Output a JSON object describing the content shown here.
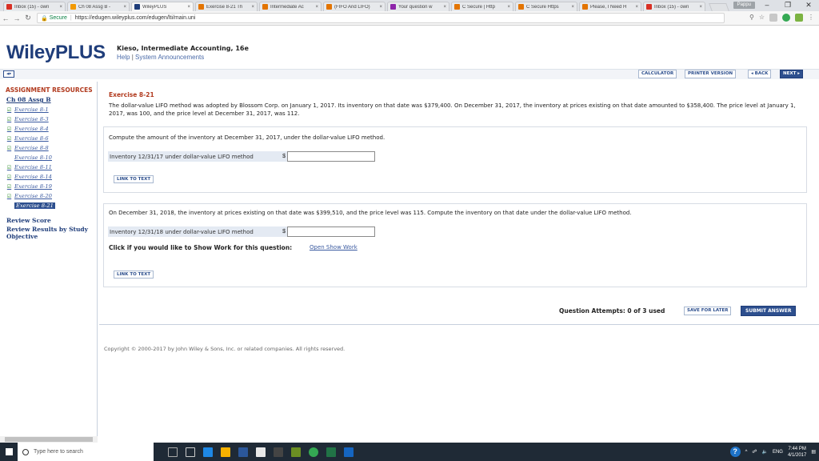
{
  "browser": {
    "tabs": [
      {
        "title": "Inbox (15) - own",
        "color": "#d93025"
      },
      {
        "title": "Ch 08 Assg B - ",
        "color": "#f29900"
      },
      {
        "title": "WileyPLUS",
        "color": "#1f3d7a",
        "active": true
      },
      {
        "title": "Exercise 8-21 Th",
        "color": "#e37400"
      },
      {
        "title": "Intermediate Ac",
        "color": "#e37400"
      },
      {
        "title": "(FIFO And LIFO)",
        "color": "#e37400"
      },
      {
        "title": "Your question w",
        "color": "#8e24aa"
      },
      {
        "title": "C Secure | Http",
        "color": "#e37400"
      },
      {
        "title": "C Secure Https",
        "color": "#e37400"
      },
      {
        "title": "Please, I Need H",
        "color": "#e37400"
      },
      {
        "title": "Inbox (15) - own",
        "color": "#d93025"
      }
    ],
    "profile_label": "Pappu",
    "secure_label": "Secure",
    "url": "https://edugen.wileyplus.com/edugen/lti/main.uni"
  },
  "header": {
    "brand": "WileyPLUS",
    "course_title": "Kieso, Intermediate Accounting, 16e",
    "help_link": "Help",
    "sep": "|",
    "announce_link": "System Announcements"
  },
  "toolbar": {
    "calculator": "CALCULATOR",
    "printer": "PRINTER VERSION",
    "back": "◂ BACK",
    "next": "NEXT ▸"
  },
  "sidebar": {
    "heading": "ASSIGNMENT RESOURCES",
    "assignment": "Ch 08 Assg B",
    "items": [
      {
        "label": "Exercise 8-1",
        "check": "☑"
      },
      {
        "label": "Exercise 8-3",
        "check": "☑"
      },
      {
        "label": "Exercise 8-4",
        "check": "☑"
      },
      {
        "label": "Exercise 8-6",
        "check": "☑"
      },
      {
        "label": "Exercise 8-8",
        "check": "☑"
      },
      {
        "label": "Exercise 8-10",
        "check": ""
      },
      {
        "label": "Exercise 8-11",
        "check": "☑"
      },
      {
        "label": "Exercise 8-14",
        "check": "☑"
      },
      {
        "label": "Exercise 8-19",
        "check": "☑"
      },
      {
        "label": "Exercise 8-20",
        "check": "☑"
      },
      {
        "label": "Exercise 8-21",
        "check": "",
        "current": true
      }
    ],
    "review_score": "Review Score",
    "review_results_line1": "Review Results by Study",
    "review_results_line2": "Objective"
  },
  "exercise": {
    "title": "Exercise 8-21",
    "text": "The dollar-value LIFO method was adopted by Blossom Corp. on January 1, 2017. Its inventory on that date was $379,400. On December 31, 2017, the inventory at prices existing on that date amounted to $358,400. The price level at January 1, 2017, was 100, and the price level at December 31, 2017, was 112."
  },
  "part1": {
    "question": "Compute the amount of the inventory at December 31, 2017, under the dollar-value LIFO method.",
    "answer_label": "Inventory 12/31/17 under dollar-value LIFO method",
    "currency": "$",
    "answer_value": "",
    "link_to_text": "LINK TO TEXT"
  },
  "part2": {
    "question": "On December 31, 2018, the inventory at prices existing on that date was $399,510, and the price level was 115. Compute the inventory on that date under the dollar-value LIFO method.",
    "answer_label": "Inventory 12/31/18 under dollar-value LIFO method",
    "currency": "$",
    "answer_value": "",
    "show_work_label": "Click if you would like to Show Work for this question:",
    "show_work_link": "Open Show Work",
    "link_to_text": "LINK TO TEXT"
  },
  "footer": {
    "attempts": "Question Attempts: 0 of 3 used",
    "save_later": "SAVE FOR LATER",
    "submit": "SUBMIT ANSWER",
    "copyright": "Copyright © 2000-2017 by John Wiley & Sons, Inc. or related companies. All rights reserved."
  },
  "taskbar": {
    "search_placeholder": "Type here to search",
    "lang": "ENG",
    "time": "7:44 PM",
    "date": "4/1/2017"
  }
}
